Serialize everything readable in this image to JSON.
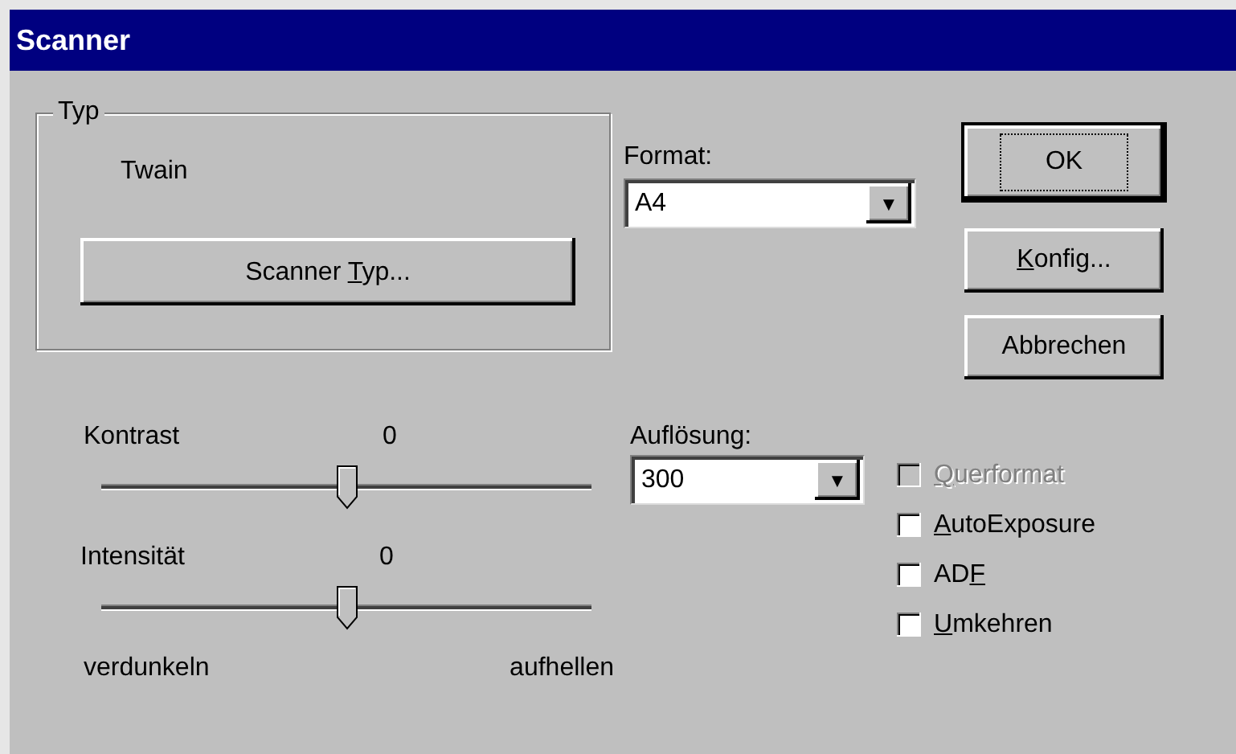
{
  "window": {
    "title": "Scanner"
  },
  "type_group": {
    "legend": "Typ",
    "value": "Twain",
    "button": {
      "label_parts": [
        {
          "text": "Scanner ",
          "underlined": false
        },
        {
          "text": "T",
          "underlined": true
        },
        {
          "text": "yp...",
          "underlined": false
        }
      ]
    }
  },
  "format": {
    "label": "Format:",
    "value": "A4",
    "arrow": "▼"
  },
  "buttons": [
    {
      "label_parts": [
        {
          "text": "OK",
          "underlined": false
        }
      ],
      "default": true
    },
    {
      "label_parts": [
        {
          "text": "K",
          "underlined": true
        },
        {
          "text": "onfig...",
          "underlined": false
        }
      ],
      "default": false
    },
    {
      "label_parts": [
        {
          "text": "Abbrechen",
          "underlined": false
        }
      ],
      "default": false
    }
  ],
  "sliders": [
    {
      "label": "Kontrast",
      "reading": "0",
      "level": 0.5
    },
    {
      "label": "Intensität",
      "reading": "0",
      "level": 0.5
    }
  ],
  "slider_scale": {
    "left": "verdunkeln",
    "right": "aufhellen"
  },
  "resolution": {
    "label": "Auflösung:",
    "value": "300",
    "arrow": "▼"
  },
  "options": [
    {
      "label_parts": [
        {
          "text": "Q",
          "underlined": true
        },
        {
          "text": "uerformat",
          "underlined": false
        }
      ],
      "checked": false,
      "disabled": true
    },
    {
      "label_parts": [
        {
          "text": "A",
          "underlined": true
        },
        {
          "text": "utoExposure",
          "underlined": false
        }
      ],
      "checked": false,
      "disabled": false
    },
    {
      "label_parts": [
        {
          "text": "AD",
          "underlined": false
        },
        {
          "text": "F",
          "underlined": true
        }
      ],
      "checked": false,
      "disabled": false
    },
    {
      "label_parts": [
        {
          "text": "U",
          "underlined": true
        },
        {
          "text": "mkehren",
          "underlined": false
        }
      ],
      "checked": false,
      "disabled": false
    }
  ]
}
